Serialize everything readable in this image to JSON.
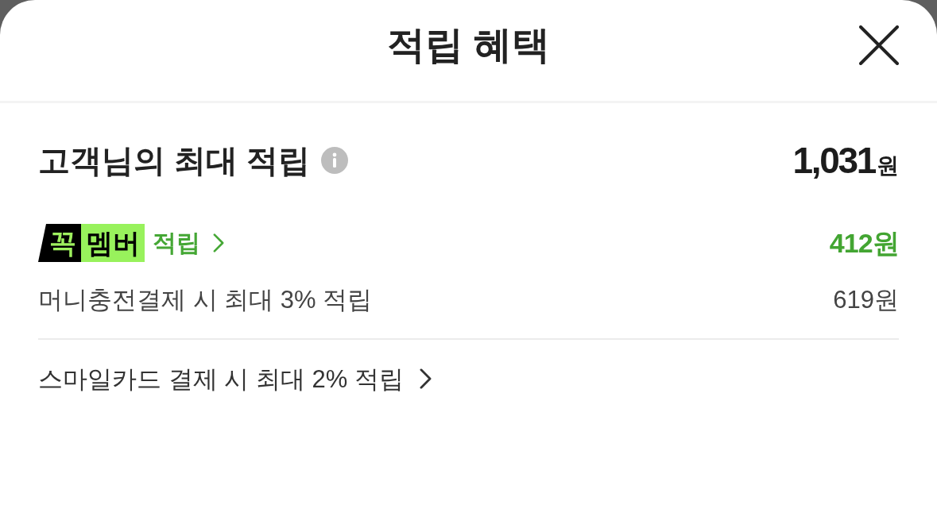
{
  "sheet": {
    "title": "적립 혜택"
  },
  "summary": {
    "label": "고객님의 최대 적립",
    "amount": "1,031",
    "unit": "원"
  },
  "benefits": [
    {
      "kind": "membership",
      "badge": {
        "mark": "꼭",
        "name": "멤버"
      },
      "label": "적립",
      "amount": "412원"
    },
    {
      "kind": "detail",
      "label": "머니충전결제 시 최대 3% 적립",
      "amount": "619원"
    }
  ],
  "card_offer": {
    "label": "스마일카드 결제 시 최대 2% 적립"
  }
}
